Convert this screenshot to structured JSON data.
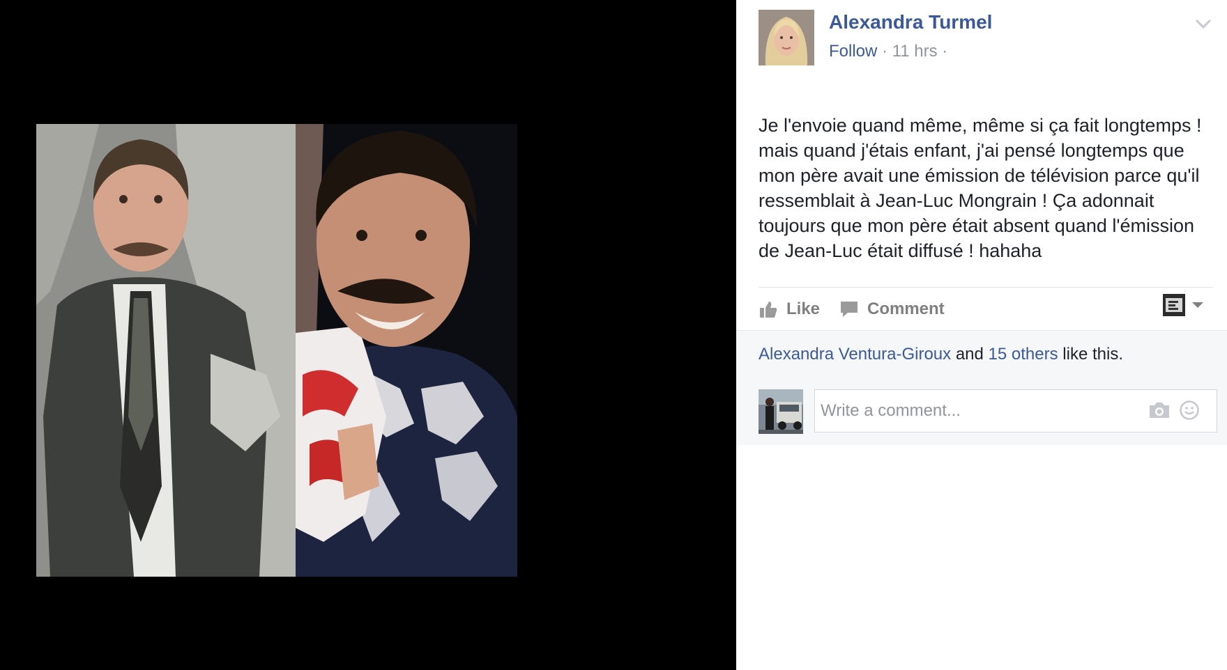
{
  "post": {
    "author": "Alexandra Turmel",
    "follow_label": "Follow",
    "separator": "·",
    "time": "11 hrs",
    "text": "Je l'envoie quand même, même si ça fait longtemps ! mais quand j'étais enfant, j'ai pensé longtemps que mon père avait une émission de télévision parce qu'il ressemblait à Jean-Luc Mongrain ! Ça adonnait toujours que mon père était absent quand l'émission de Jean-Luc était diffusé ! hahaha"
  },
  "actions": {
    "like_label": "Like",
    "comment_label": "Comment"
  },
  "likes": {
    "first_name": "Alexandra Ventura-Giroux",
    "and_text": "and",
    "others_link": "15 others",
    "suffix": "like this."
  },
  "comment": {
    "placeholder": "Write a comment..."
  },
  "colors": {
    "link": "#3b5998",
    "meta": "#90949c",
    "action": "#7f7f7f",
    "text": "#1d2129",
    "stage": "#000000"
  },
  "icons": [
    "chevron-down-icon",
    "thumbs-up-icon",
    "comment-icon",
    "dropdown-caret-icon",
    "camera-icon",
    "emoji-icon"
  ]
}
